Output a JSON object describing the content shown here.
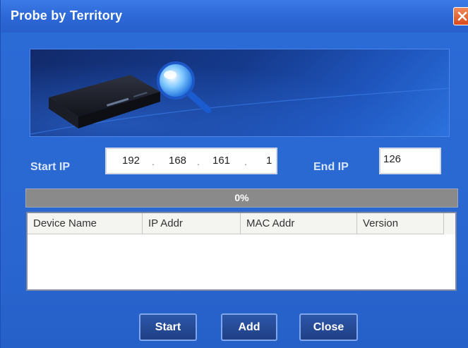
{
  "window": {
    "title": "Probe by Territory"
  },
  "form": {
    "start_ip_label": "Start IP",
    "start_ip": [
      "192",
      "168",
      "161",
      "1"
    ],
    "end_ip_label": "End IP",
    "end_ip": "126"
  },
  "progress": {
    "value": 0,
    "label": "0%"
  },
  "table": {
    "columns": [
      "Device Name",
      "IP Addr",
      "MAC Addr",
      "Version"
    ],
    "rows": []
  },
  "buttons": {
    "start": "Start",
    "add": "Add",
    "close": "Close"
  },
  "icons": {
    "close": "close-icon",
    "banner_device": "network-device-icon",
    "banner_magnifier": "magnifier-icon"
  },
  "colors": {
    "window_blue": "#2a6ad4",
    "title_close": "#d94a1c",
    "progress_track": "#8a8a8a",
    "button_blue": "#1f3f86"
  }
}
